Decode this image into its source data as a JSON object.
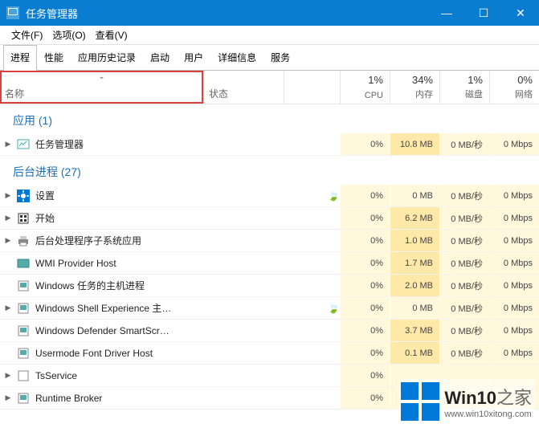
{
  "window": {
    "title": "任务管理器"
  },
  "winbtns": {
    "min": "—",
    "max": "☐",
    "close": "✕"
  },
  "menu": {
    "file": "文件(F)",
    "options": "选项(O)",
    "view": "查看(V)"
  },
  "tabs": {
    "processes": "进程",
    "performance": "性能",
    "history": "应用历史记录",
    "startup": "启动",
    "users": "用户",
    "details": "详细信息",
    "services": "服务"
  },
  "cols": {
    "name": "名称",
    "status": "状态",
    "chev": "⌄"
  },
  "metrics": {
    "cpu": {
      "pct": "1%",
      "lbl": "CPU"
    },
    "mem": {
      "pct": "34%",
      "lbl": "内存"
    },
    "disk": {
      "pct": "1%",
      "lbl": "磁盘"
    },
    "net": {
      "pct": "0%",
      "lbl": "网络"
    }
  },
  "groups": {
    "apps": "应用 (1)",
    "bg": "后台进程 (27)"
  },
  "rows": {
    "r0": {
      "name": "任务管理器",
      "cpu": "0%",
      "mem": "10.8 MB",
      "disk": "0 MB/秒",
      "net": "0 Mbps"
    },
    "r1": {
      "name": "设置",
      "cpu": "0%",
      "mem": "0 MB",
      "disk": "0 MB/秒",
      "net": "0 Mbps"
    },
    "r2": {
      "name": "开始",
      "cpu": "0%",
      "mem": "6.2 MB",
      "disk": "0 MB/秒",
      "net": "0 Mbps"
    },
    "r3": {
      "name": "后台处理程序子系统应用",
      "cpu": "0%",
      "mem": "1.0 MB",
      "disk": "0 MB/秒",
      "net": "0 Mbps"
    },
    "r4": {
      "name": "WMI Provider Host",
      "cpu": "0%",
      "mem": "1.7 MB",
      "disk": "0 MB/秒",
      "net": "0 Mbps"
    },
    "r5": {
      "name": "Windows 任务的主机进程",
      "cpu": "0%",
      "mem": "2.0 MB",
      "disk": "0 MB/秒",
      "net": "0 Mbps"
    },
    "r6": {
      "name": "Windows Shell Experience 主…",
      "cpu": "0%",
      "mem": "0 MB",
      "disk": "0 MB/秒",
      "net": "0 Mbps"
    },
    "r7": {
      "name": "Windows Defender SmartScr…",
      "cpu": "0%",
      "mem": "3.7 MB",
      "disk": "0 MB/秒",
      "net": "0 Mbps"
    },
    "r8": {
      "name": "Usermode Font Driver Host",
      "cpu": "0%",
      "mem": "0.1 MB",
      "disk": "0 MB/秒",
      "net": "0 Mbps"
    },
    "r9": {
      "name": "TsService",
      "cpu": "0%",
      "mem": "",
      "disk": "",
      "net": ""
    },
    "r10": {
      "name": "Runtime Broker",
      "cpu": "0%",
      "mem": "",
      "disk": "",
      "net": ""
    }
  },
  "watermark": {
    "brand": "Win10",
    "suffix": "之家",
    "url": "www.win10xitong.com"
  }
}
